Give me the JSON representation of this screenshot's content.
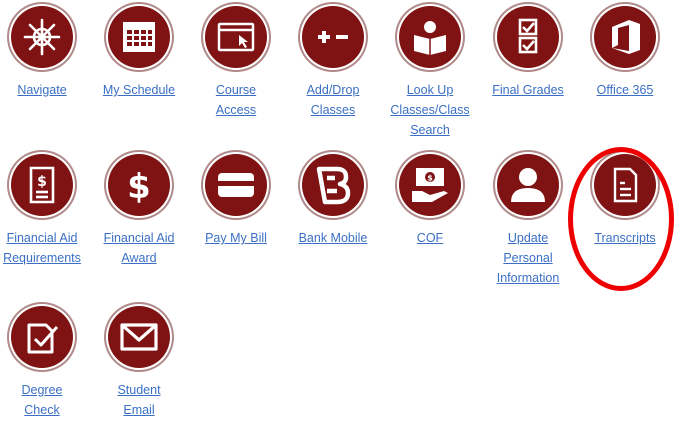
{
  "tiles": [
    {
      "label": "Navigate",
      "icon": "ship-wheel-icon"
    },
    {
      "label": "My Schedule",
      "icon": "calendar-icon"
    },
    {
      "label": "Course\nAccess",
      "icon": "browser-window-icon"
    },
    {
      "label": "Add/Drop\nClasses",
      "icon": "plus-minus-icon"
    },
    {
      "label": "Look Up\nClasses/Class\nSearch",
      "icon": "reader-icon"
    },
    {
      "label": "Final Grades",
      "icon": "checklist-icon"
    },
    {
      "label": "Office 365",
      "icon": "office-logo-icon"
    },
    {
      "label": "Financial Aid\nRequirements",
      "icon": "dollar-document-icon"
    },
    {
      "label": "Financial Aid\nAward",
      "icon": "dollar-sign-icon"
    },
    {
      "label": "Pay My Bill",
      "icon": "credit-card-icon"
    },
    {
      "label": "Bank Mobile",
      "icon": "bank-mobile-logo-icon"
    },
    {
      "label": "COF",
      "icon": "cash-hand-icon"
    },
    {
      "label": "Update\nPersonal\nInformation",
      "icon": "user-icon"
    },
    {
      "label": "Transcripts",
      "icon": "document-icon"
    },
    {
      "label": "Degree\nCheck",
      "icon": "document-check-icon"
    },
    {
      "label": "Student\nEmail",
      "icon": "envelope-icon"
    }
  ],
  "colors": {
    "tile_background": "#7f1212",
    "link": "#3a6fc4",
    "highlight": "#ee0000"
  }
}
